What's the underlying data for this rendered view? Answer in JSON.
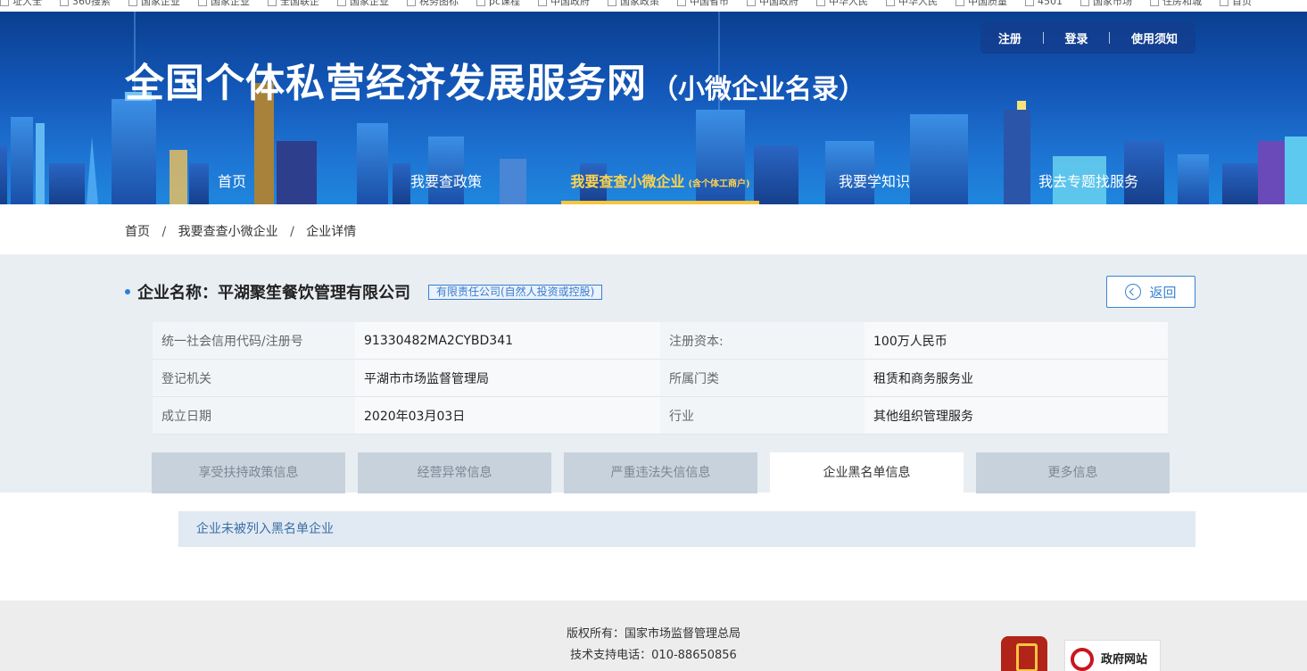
{
  "bookmarks": [
    "址大全",
    "360搜索",
    "国家企业",
    "国家企业",
    "全国联企",
    "国家企业",
    "税务图标",
    "pc课程",
    "中国政府",
    "国家政策",
    "中国省市",
    "中国政府",
    "中华人民",
    "中华人民",
    "中国质量",
    "4501",
    "国家市场",
    "住房和城",
    "首页"
  ],
  "header": {
    "title": "全国个体私营经济发展服务网",
    "subtitle": "（小微企业名录）",
    "user_links": {
      "register": "注册",
      "login": "登录",
      "guide": "使用须知"
    }
  },
  "nav": {
    "items": [
      {
        "label": "首页"
      },
      {
        "label": "我要查政策"
      },
      {
        "label": "我要查查小微企业",
        "sub": "(含个体工商户)"
      },
      {
        "label": "我要学知识"
      },
      {
        "label": "我去专题找服务"
      }
    ]
  },
  "breadcrumb": [
    "首页",
    "我要查查小微企业",
    "企业详情"
  ],
  "company": {
    "label": "企业名称：",
    "name": "平湖聚笙餐饮管理有限公司",
    "type": "有限责任公司(自然人投资或控股)",
    "back_label": "返回",
    "fields": [
      {
        "k1": "统一社会信用代码/注册号",
        "v1": "91330482MA2CYBD341",
        "k2": "注册资本:",
        "v2": "100万人民币"
      },
      {
        "k1": "登记机关",
        "v1": "平湖市市场监督管理局",
        "k2": "所属门类",
        "v2": "租赁和商务服务业"
      },
      {
        "k1": "成立日期",
        "v1": "2020年03月03日",
        "k2": "行业",
        "v2": "其他组织管理服务"
      }
    ]
  },
  "tabs": [
    "享受扶持政策信息",
    "经营异常信息",
    "严重违法失信信息",
    "企业黑名单信息",
    "更多信息"
  ],
  "active_tab": "企业黑名单信息",
  "result": "企业未被列入黑名单企业",
  "footer": {
    "copyright": "版权所有：国家市场监督管理总局",
    "phone": "技术支持电话：010-88650856",
    "gov_badge": "政府网站"
  },
  "colors": {
    "nav_active": "#ffd34d",
    "accent": "#3a83d2",
    "band": "#e9eef3"
  }
}
